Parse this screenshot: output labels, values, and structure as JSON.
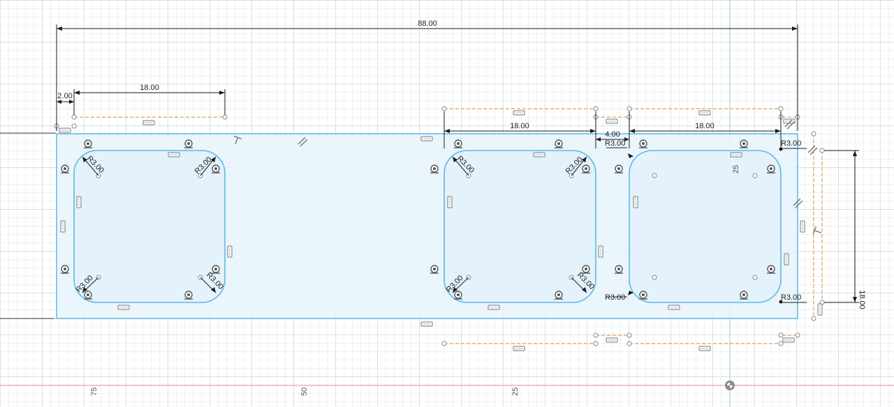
{
  "sketch": {
    "dimensions": {
      "overall_width": "88.00",
      "offset_left": "2.00",
      "left_pocket_width": "18.00",
      "mid_pocket_width": "18.00",
      "gap_width": "4.00",
      "right_pocket_width": "18.00",
      "pocket_height": "18.00"
    },
    "radii": {
      "r1": "R3.00",
      "r2": "R3.00",
      "r3": "R3.00",
      "r4": "R3.00",
      "r5": "R3.00",
      "r6": "R3.00",
      "r7": "R3.00",
      "r8": "R3.00",
      "r9": "R3.00",
      "r10": "R3.00",
      "r11": "R3.00",
      "r12": "R3.00"
    },
    "ruler": {
      "x_labels": [
        "75",
        "50",
        "25"
      ],
      "y_label": "25"
    },
    "colors": {
      "profile_fill": "#e6f4fc",
      "profile_line": "#5fb8e2",
      "construction": "#e8a05a",
      "grid_minor": "#eef0f3",
      "grid_major": "#dadee3",
      "axis_x": "#e59a9a",
      "axis_y": "#9fdc9f",
      "dimension": "#1a1a1a"
    }
  }
}
